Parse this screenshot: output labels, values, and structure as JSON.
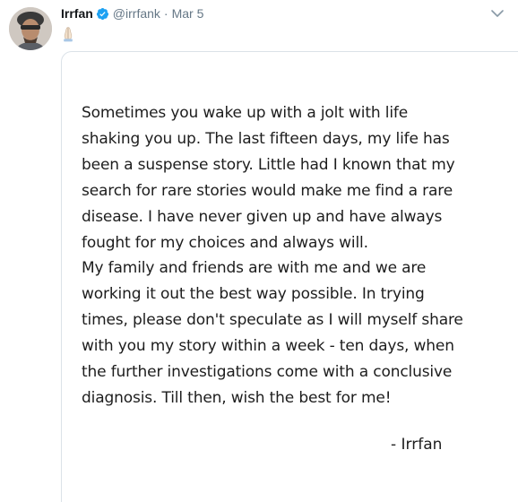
{
  "tweet": {
    "author": {
      "display_name": "Irrfan",
      "handle": "@irrfank",
      "verified": true
    },
    "separator": "·",
    "date": "Mar 5",
    "icons": {
      "avatar": "profile-photo",
      "verified": "verified-badge-icon",
      "menu": "chevron-down-icon",
      "emoji": "folded-hands-emoji"
    },
    "colors": {
      "verified_badge": "#1da1f2",
      "secondary_text": "#657786",
      "media_border": "#dbe2e8"
    },
    "image_text": {
      "lines": [
        "Sometimes you wake up with a jolt with life",
        "shaking you up. The last fifteen days, my life has",
        "been a suspense story. Little had I known that my",
        "search for rare stories would make me find a rare",
        "disease. I have never given up and have always",
        "fought for my choices and always will.",
        "My family and friends are with me and we are",
        "working it out the best way possible. In trying",
        "times, please don't speculate as I will myself share",
        "with you my story within a week - ten days, when",
        "the further investigations come with a conclusive",
        "diagnosis. Till then, wish the best for me!"
      ],
      "signature": "- Irrfan"
    }
  }
}
